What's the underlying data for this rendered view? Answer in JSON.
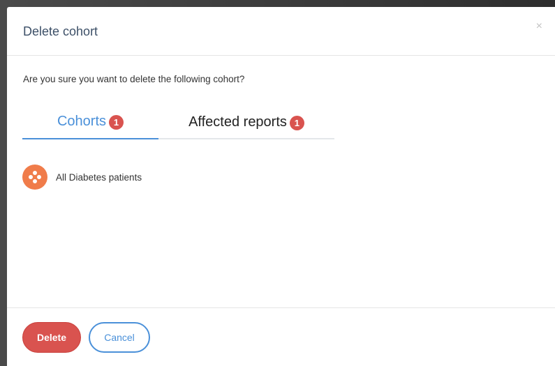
{
  "dialog": {
    "title": "Delete cohort",
    "close_label": "×",
    "question": "Are you sure you want to delete the following cohort?"
  },
  "tabs": [
    {
      "label": "Cohorts",
      "count": "1",
      "active": true
    },
    {
      "label": "Affected reports",
      "count": "1",
      "active": false
    }
  ],
  "cohorts": [
    {
      "name": "All Diabetes patients",
      "icon": "cohort-icon"
    }
  ],
  "footer": {
    "delete_label": "Delete",
    "cancel_label": "Cancel"
  },
  "colors": {
    "accent": "#4a90d9",
    "danger": "#d9534f",
    "cohort_icon": "#f07c4a",
    "title": "#3d5068"
  }
}
